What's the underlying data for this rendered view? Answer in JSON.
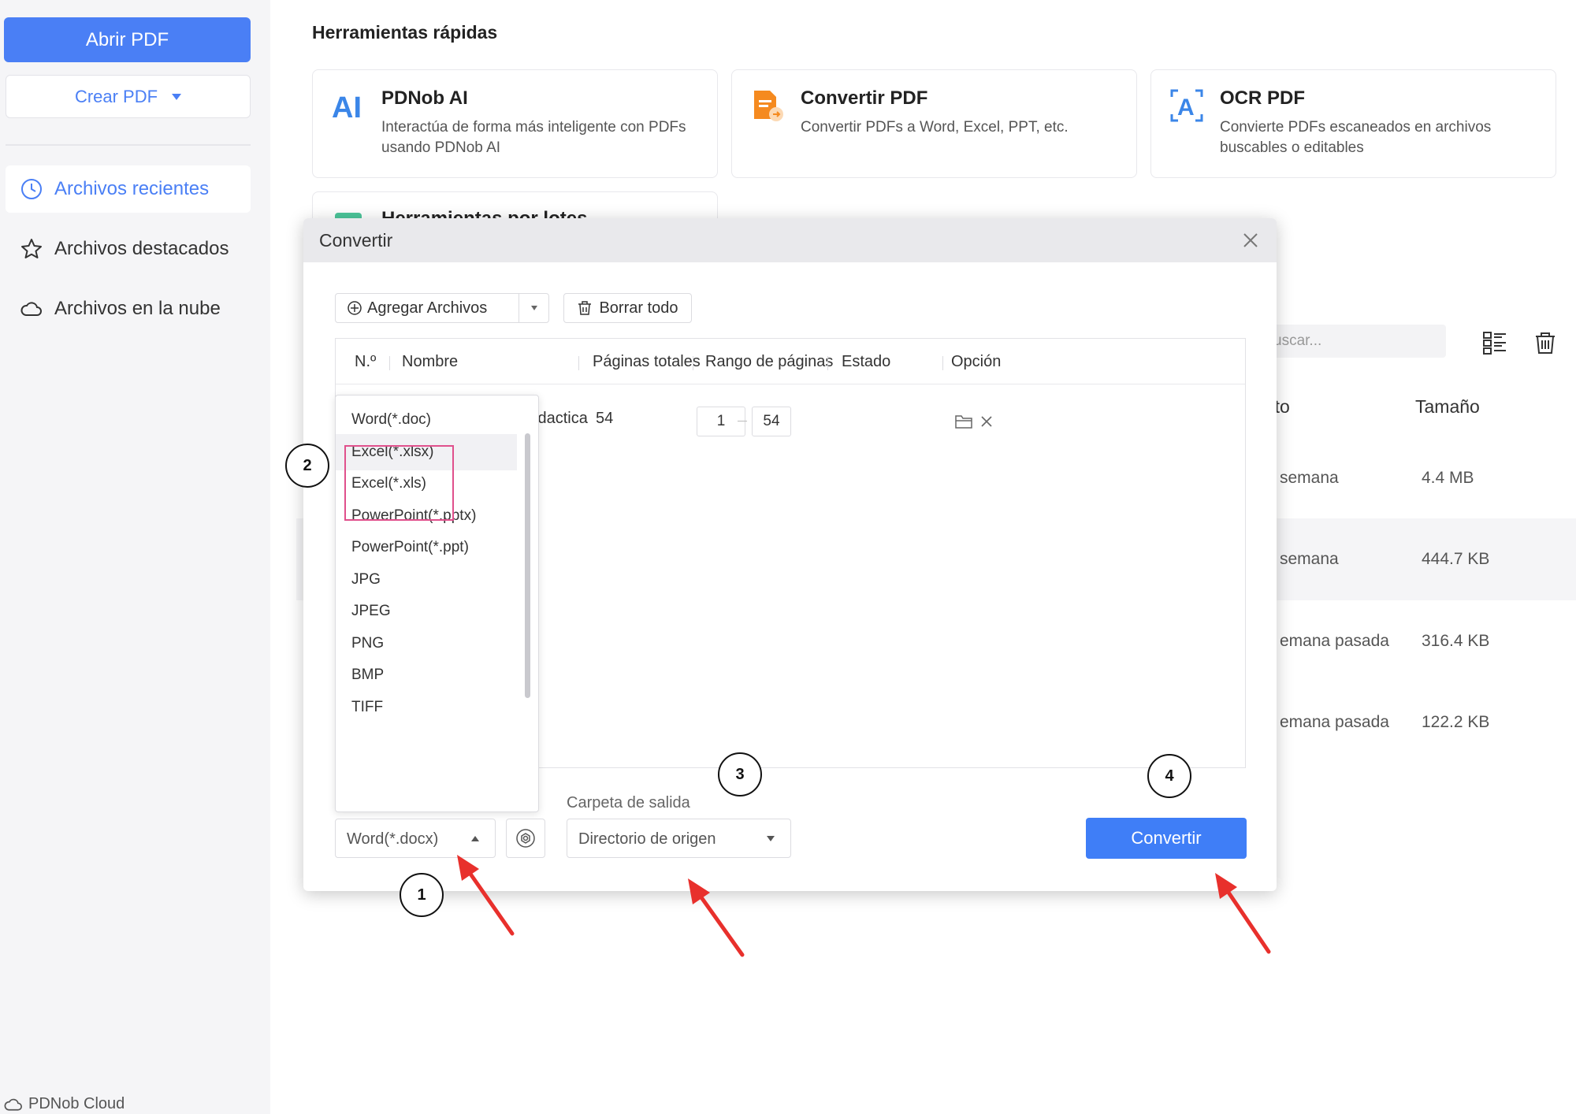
{
  "sidebar": {
    "open_pdf": "Abrir PDF",
    "create_pdf": "Crear PDF",
    "items": [
      {
        "label": "Archivos recientes"
      },
      {
        "label": "Archivos destacados"
      },
      {
        "label": "Archivos en la nube"
      }
    ],
    "cloud": "PDNob Cloud"
  },
  "quick_tools": {
    "title": "Herramientas rápidas",
    "cards": [
      {
        "name": "PDNob AI",
        "desc": "Interactúa de forma más inteligente con PDFs usando PDNob AI"
      },
      {
        "name": "Convertir PDF",
        "desc": "Convertir PDFs a Word, Excel, PPT, etc."
      },
      {
        "name": "OCR PDF",
        "desc": "Convierte PDFs escaneados en archivos buscables o editables"
      },
      {
        "name": "Herramientas por lotes"
      }
    ]
  },
  "files": {
    "search_placeholder": "uscar...",
    "col_opened": "rto",
    "col_size": "Tamaño",
    "rows": [
      {
        "opened": "semana",
        "size": "4.4 MB"
      },
      {
        "opened": "semana",
        "size": "444.7 KB"
      },
      {
        "opened": "emana pasada",
        "size": "316.4 KB"
      },
      {
        "opened": "emana pasada",
        "size": "122.2 KB"
      }
    ]
  },
  "dialog": {
    "title": "Convertir",
    "add_files": "Agregar Archivos",
    "clear_all": "Borrar todo",
    "columns": {
      "no": "N.º",
      "name": "Nombre",
      "pages": "Páginas totales",
      "range": "Rango de páginas",
      "status": "Estado",
      "option": "Opción"
    },
    "row": {
      "name": "dad didactica",
      "pages": "54",
      "range_from": "1",
      "range_to": "54"
    },
    "format_options": [
      "Word(*.doc)",
      "Excel(*.xlsx)",
      "Excel(*.xls)",
      "PowerPoint(*.pptx)",
      "PowerPoint(*.ppt)",
      "JPG",
      "JPEG",
      "PNG",
      "BMP",
      "TIFF"
    ],
    "selected_format": "Word(*.docx)",
    "output_label": "Carpeta de salida",
    "output_value": "Directorio de origen",
    "convert": "Convertir"
  },
  "annotations": {
    "steps": [
      "1",
      "2",
      "3",
      "4"
    ],
    "highlight_color": "#e0508c",
    "arrow_color": "#e8302c"
  },
  "colors": {
    "accent": "#4a7ff5"
  }
}
